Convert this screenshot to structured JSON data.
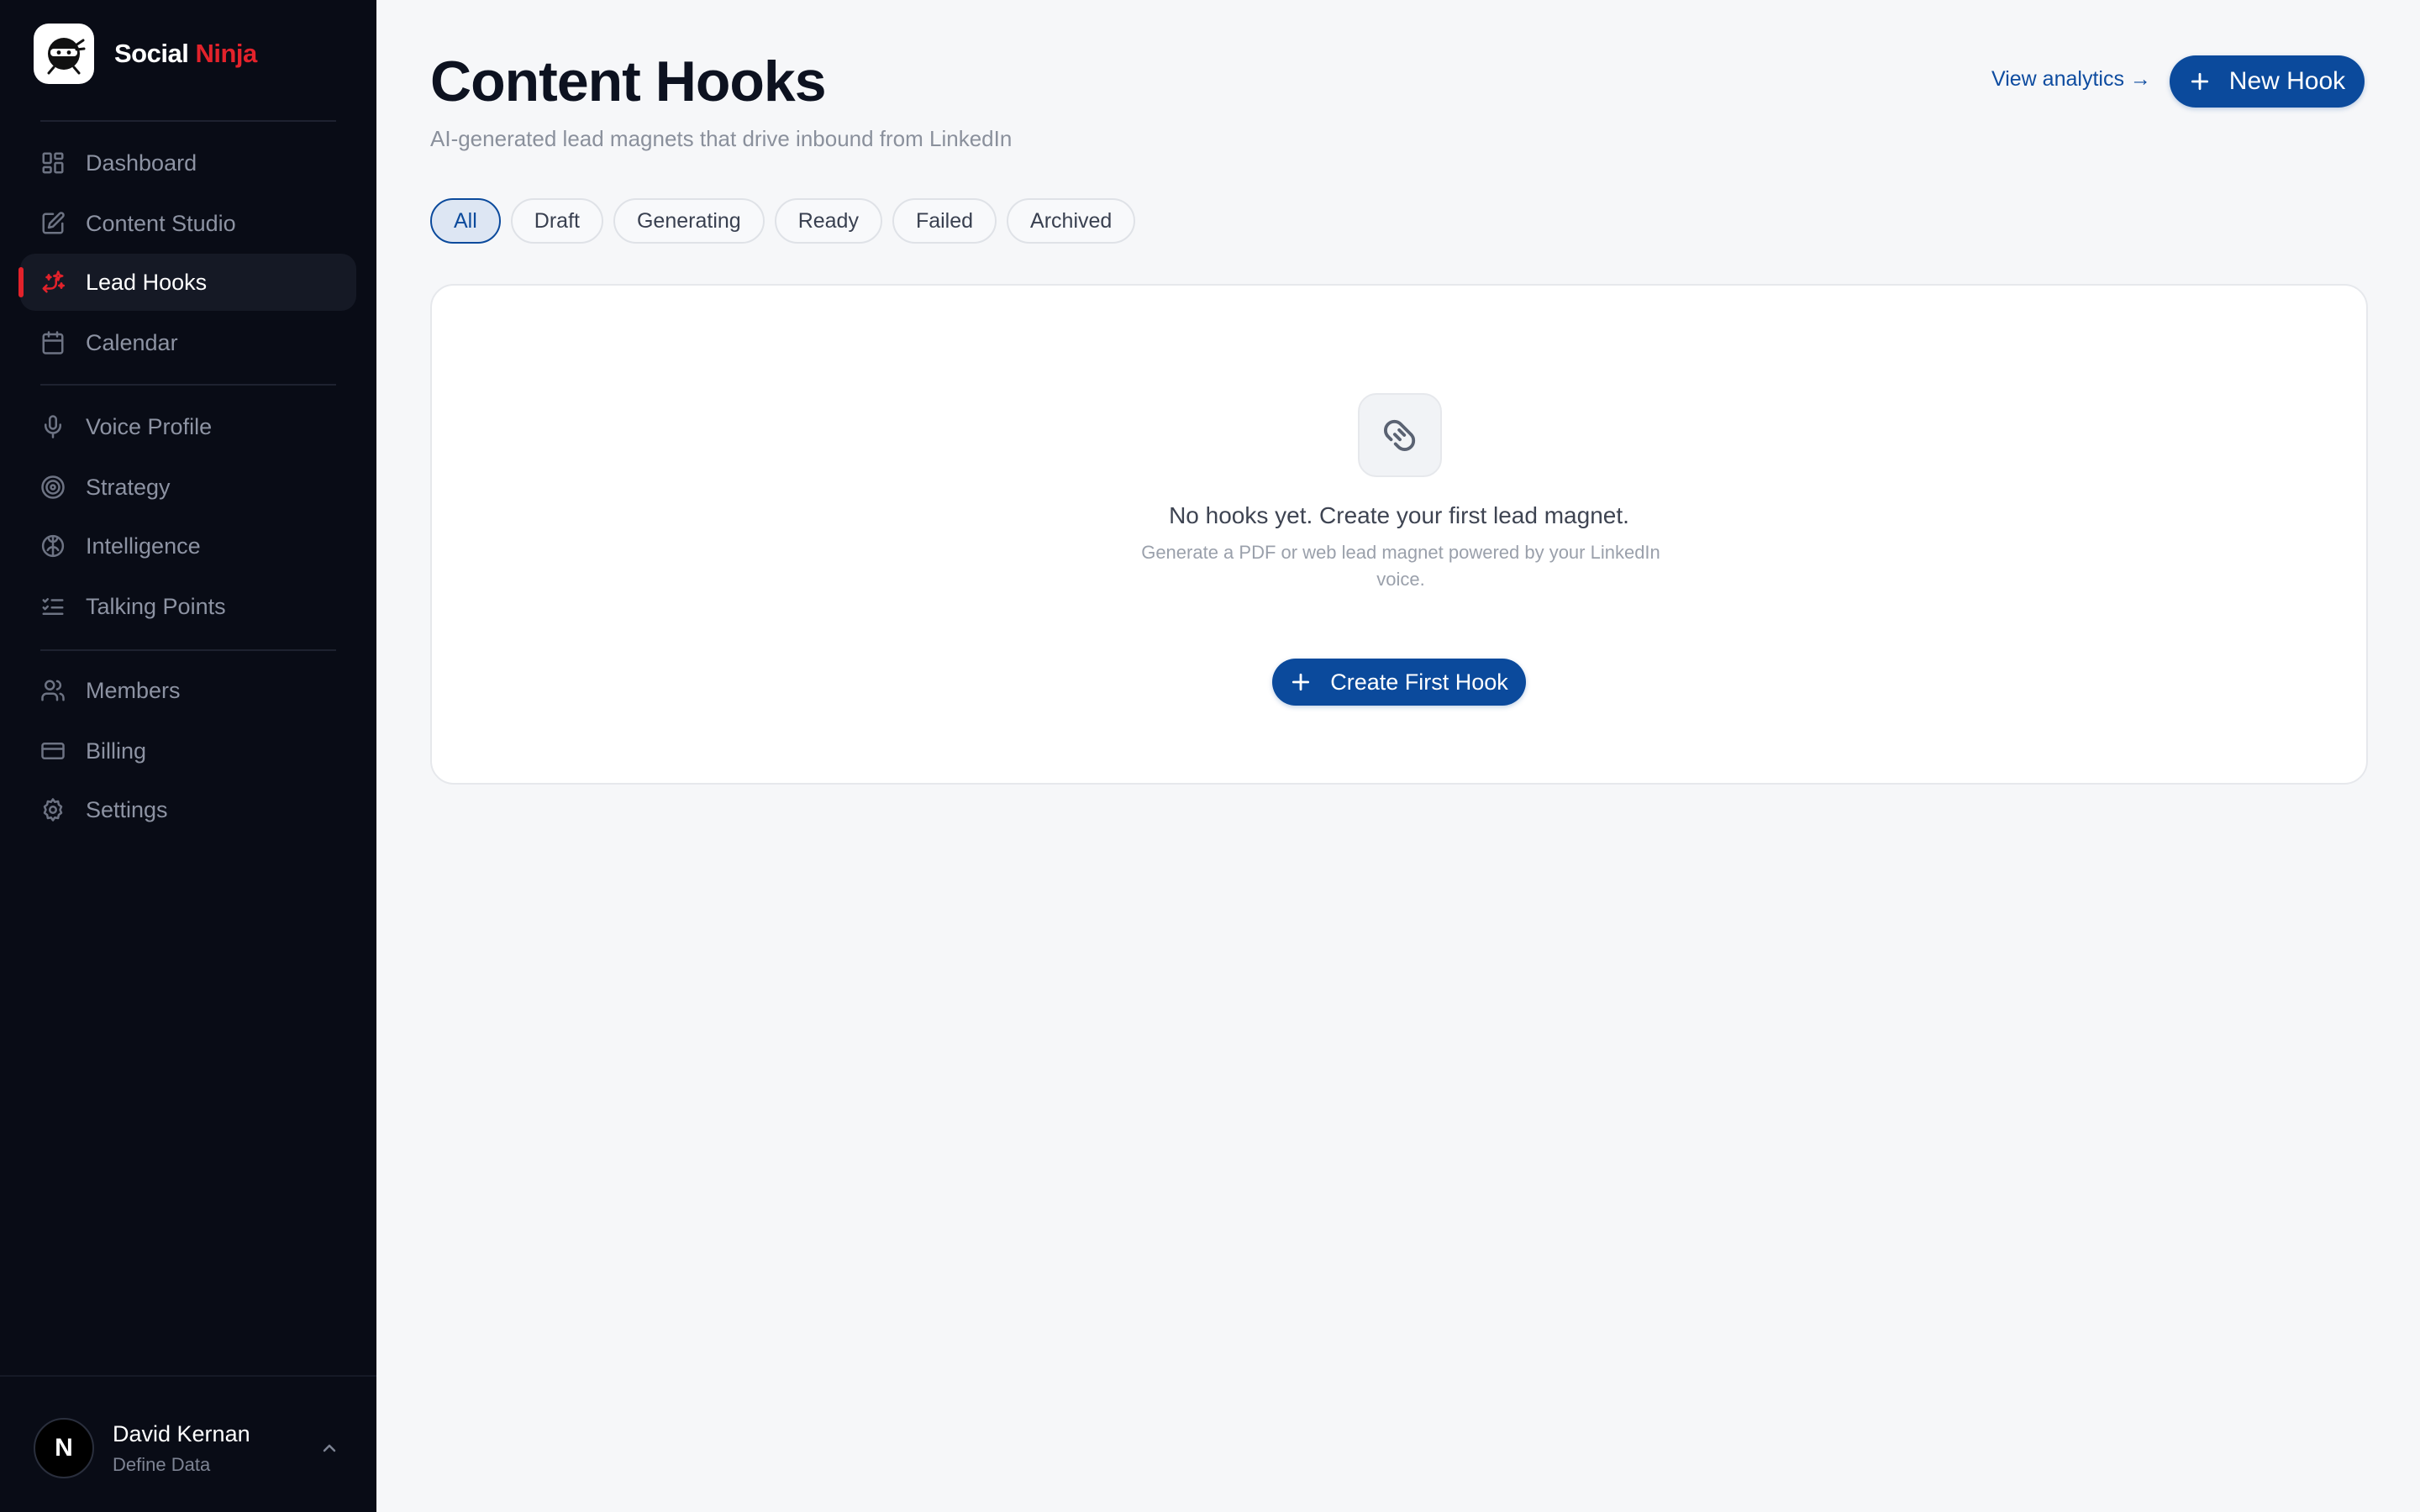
{
  "brand": {
    "name_prefix": "Social",
    "name_accent": "Ninja"
  },
  "sidebar": {
    "groups": [
      [
        {
          "label": "Dashboard",
          "icon": "dashboard-icon",
          "active": false
        },
        {
          "label": "Content Studio",
          "icon": "edit-icon",
          "active": false
        },
        {
          "label": "Lead Hooks",
          "icon": "magnet-sparkle-icon",
          "active": true
        },
        {
          "label": "Calendar",
          "icon": "calendar-icon",
          "active": false
        }
      ],
      [
        {
          "label": "Voice Profile",
          "icon": "microphone-icon",
          "active": false
        },
        {
          "label": "Strategy",
          "icon": "target-icon",
          "active": false
        },
        {
          "label": "Intelligence",
          "icon": "brain-icon",
          "active": false
        },
        {
          "label": "Talking Points",
          "icon": "checklist-icon",
          "active": false
        }
      ],
      [
        {
          "label": "Members",
          "icon": "users-icon",
          "active": false
        },
        {
          "label": "Billing",
          "icon": "credit-card-icon",
          "active": false
        },
        {
          "label": "Settings",
          "icon": "gear-icon",
          "active": false
        }
      ]
    ],
    "user": {
      "initial": "N",
      "name": "David Kernan",
      "org": "Define Data"
    }
  },
  "header": {
    "title": "Content Hooks",
    "subtitle": "AI-generated lead magnets that drive inbound from LinkedIn",
    "view_analytics": "View analytics →",
    "new_hook": "New Hook"
  },
  "filters": [
    "All",
    "Draft",
    "Generating",
    "Ready",
    "Failed",
    "Archived"
  ],
  "active_filter": "All",
  "empty_state": {
    "title": "No hooks yet. Create your first lead magnet.",
    "description": "Generate a PDF or web lead magnet powered by your LinkedIn voice.",
    "cta": "Create First Hook"
  },
  "colors": {
    "sidebar_bg": "#090c16",
    "accent_red": "#e3222b",
    "primary_blue": "#0b4a9c",
    "page_bg": "#f6f7f9"
  }
}
